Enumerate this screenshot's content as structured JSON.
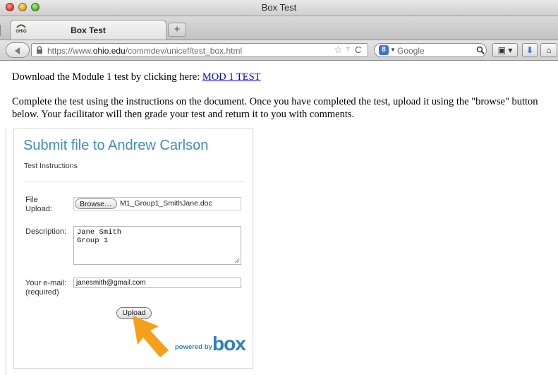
{
  "window": {
    "title": "Box Test"
  },
  "tab": {
    "title": "Box Test",
    "favicon_text": "OHIO",
    "new_tab_label": "+"
  },
  "navbar": {
    "url_prefix": "https://www.",
    "url_domain": "ohio.edu",
    "url_path": "/commdev/unicef/test_box.html",
    "search_engine_badge": "8",
    "search_placeholder": "Google"
  },
  "page": {
    "download_text": "Download the Module 1 test by clicking here: ",
    "download_link": "MOD 1 TEST",
    "instructions": "Complete the test using the instructions on the document. Once you have completed the test, upload it using the \"browse\" button below. Your facilitator will then grade your test and return it to you with comments."
  },
  "widget": {
    "title": "Submit file to Andrew Carlson",
    "subtitle": "Test Instructions",
    "file_label": "File\nUpload:",
    "browse_label": "Browse…",
    "file_name": "M1_Group1_SmithJane.doc",
    "description_label": "Description:",
    "description_value": "Jane Smith\nGroup 1",
    "email_label": "Your e-mail:\n(required)",
    "email_value": "janesmith@gmail.com",
    "upload_label": "Upload",
    "powered_by": "powered by",
    "brand": "box"
  },
  "colors": {
    "brand_blue": "#3d8cc7",
    "link": "#0000ee",
    "annotation_arrow": "#f5a01a"
  }
}
